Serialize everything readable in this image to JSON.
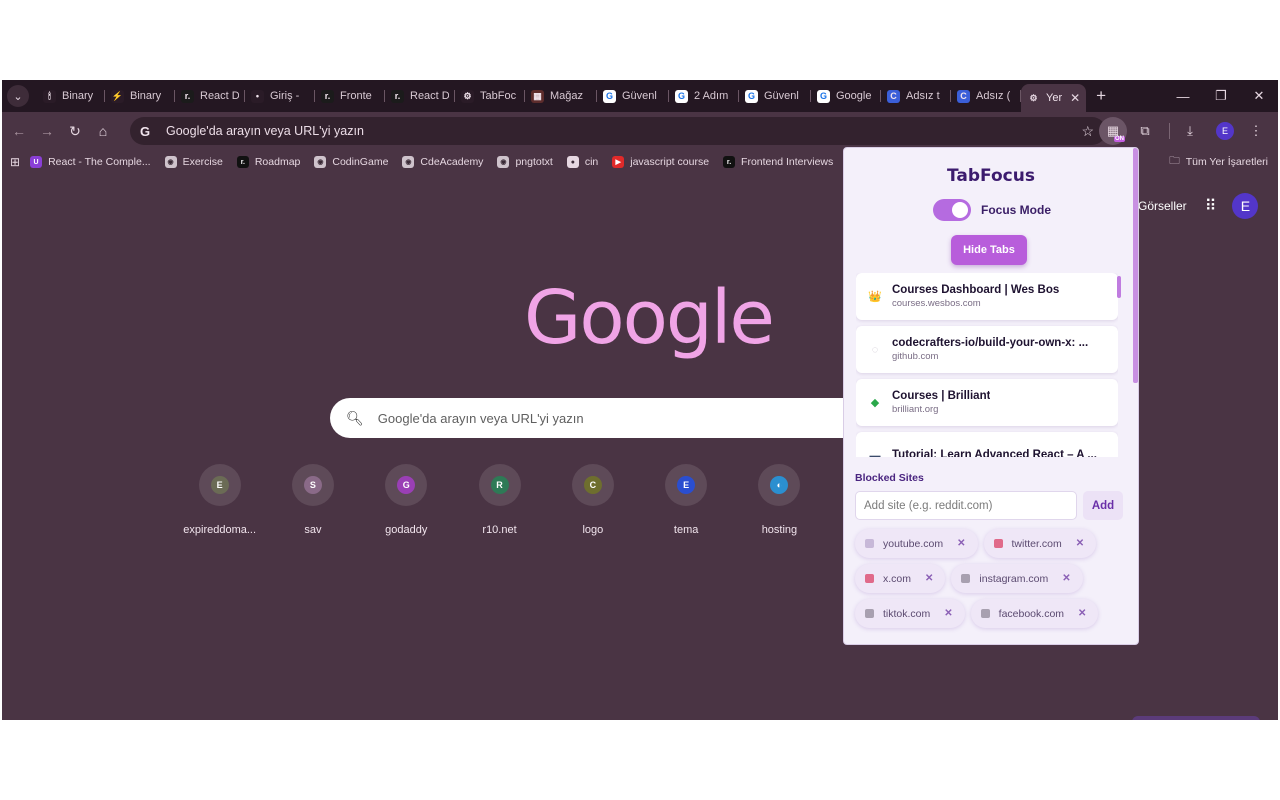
{
  "tabs": [
    {
      "label": "Binary",
      "fav_color": "#2a1b27",
      "fav_text": "🕯"
    },
    {
      "label": "Binary",
      "fav_color": "#2a1b27",
      "fav_text": "⚡"
    },
    {
      "label": "React D",
      "fav_color": "#1b1b1b",
      "fav_text": "r."
    },
    {
      "label": "Giriş - ",
      "fav_color": "#2a1b27",
      "fav_text": "•"
    },
    {
      "label": "Fronte",
      "fav_color": "#1b1b1b",
      "fav_text": "r."
    },
    {
      "label": "React D",
      "fav_color": "#1b1b1b",
      "fav_text": "r."
    },
    {
      "label": "TabFoc",
      "fav_color": "#2a1b27",
      "fav_text": "⚙"
    },
    {
      "label": "Mağaz",
      "fav_color": "#5d2c2c",
      "fav_text": "▦"
    },
    {
      "label": "Güvenl",
      "fav_color": "#ffffff",
      "fav_text": "G"
    },
    {
      "label": "2 Adım",
      "fav_color": "#ffffff",
      "fav_text": "G"
    },
    {
      "label": "Güvenl",
      "fav_color": "#ffffff",
      "fav_text": "G"
    },
    {
      "label": "Google",
      "fav_color": "#ffffff",
      "fav_text": "G"
    },
    {
      "label": "Adsız t",
      "fav_color": "#3b5fd9",
      "fav_text": "C"
    },
    {
      "label": "Adsız (",
      "fav_color": "#3b5fd9",
      "fav_text": "C"
    }
  ],
  "active_tab": {
    "label": "Yer",
    "close": "✕"
  },
  "new_tab": "+",
  "window": {
    "minimize": "—",
    "restore": "❐",
    "close": "✕"
  },
  "omnibox": {
    "text": "Google'da arayın veya URL'yi yazın"
  },
  "profile_initial": "E",
  "bookmarks": [
    {
      "label": "React - The Comple...",
      "fav_color": "#8a3fd6",
      "fav_text": "U"
    },
    {
      "label": "Exercise",
      "fav_color": "#cfc3cc",
      "fav_text": "◉"
    },
    {
      "label": "Roadmap",
      "fav_color": "#111111",
      "fav_text": "r."
    },
    {
      "label": "CodinGame",
      "fav_color": "#cfc3cc",
      "fav_text": "◉"
    },
    {
      "label": "CdeAcademy",
      "fav_color": "#cfc3cc",
      "fav_text": "◉"
    },
    {
      "label": "pngtotxt",
      "fav_color": "#cfc3cc",
      "fav_text": "◉"
    },
    {
      "label": "cin",
      "fav_color": "#e6d7e1",
      "fav_text": "●"
    },
    {
      "label": "javascript course",
      "fav_color": "#e02a2a",
      "fav_text": "▶"
    },
    {
      "label": "Frontend Interviews",
      "fav_color": "#111111",
      "fav_text": "r."
    }
  ],
  "bookmarks_all": "Tüm Yer İşaretleri",
  "ntp": {
    "logo": "Google",
    "search_placeholder": "Google'da arayın veya URL'yi yazın",
    "images_link": "Görseller",
    "account_initial": "E",
    "shortcuts": [
      {
        "label": "expireddoma...",
        "letter": "E",
        "color": "#6b6b55"
      },
      {
        "label": "sav",
        "letter": "S",
        "color": "#8a6a88"
      },
      {
        "label": "godaddy",
        "letter": "G",
        "color": "#9a3fb5"
      },
      {
        "label": "r10.net",
        "letter": "R",
        "color": "#2e7a56"
      },
      {
        "label": "logo",
        "letter": "C",
        "color": "#6e6e2e"
      },
      {
        "label": "tema",
        "letter": "E",
        "color": "#2a4ed0"
      },
      {
        "label": "hosting",
        "letter": "◐",
        "color": "#2b8fd0"
      }
    ]
  },
  "popup": {
    "title": "TabFocus",
    "focus_mode_label": "Focus Mode",
    "focus_mode_on": true,
    "hide_tabs_label": "Hide Tabs",
    "tab_cards": [
      {
        "title": "Courses Dashboard | Wes Bos",
        "url": "courses.wesbos.com",
        "icon": "👑"
      },
      {
        "title": "codecrafters-io/build-your-own-x: ...",
        "url": "github.com",
        "icon": "◌"
      },
      {
        "title": "Courses | Brilliant",
        "url": "brilliant.org",
        "icon": "◆"
      },
      {
        "title": "Tutorial: Learn Advanced React – A ...",
        "url": "",
        "icon": "▬"
      }
    ],
    "blocked_title": "Blocked Sites",
    "add_placeholder": "Add site (e.g. reddit.com)",
    "add_label": "Add",
    "blocked_sites": [
      {
        "domain": "youtube.com",
        "fav_color": "#c7b8d8"
      },
      {
        "domain": "twitter.com",
        "fav_color": "#e06a8a"
      },
      {
        "domain": "x.com",
        "fav_color": "#e06a8a"
      },
      {
        "domain": "instagram.com",
        "fav_color": "#a8a0b0"
      },
      {
        "domain": "tiktok.com",
        "fav_color": "#a8a0b0"
      },
      {
        "domain": "facebook.com",
        "fav_color": "#a8a0b0"
      }
    ],
    "remove_glyph": "✕"
  }
}
